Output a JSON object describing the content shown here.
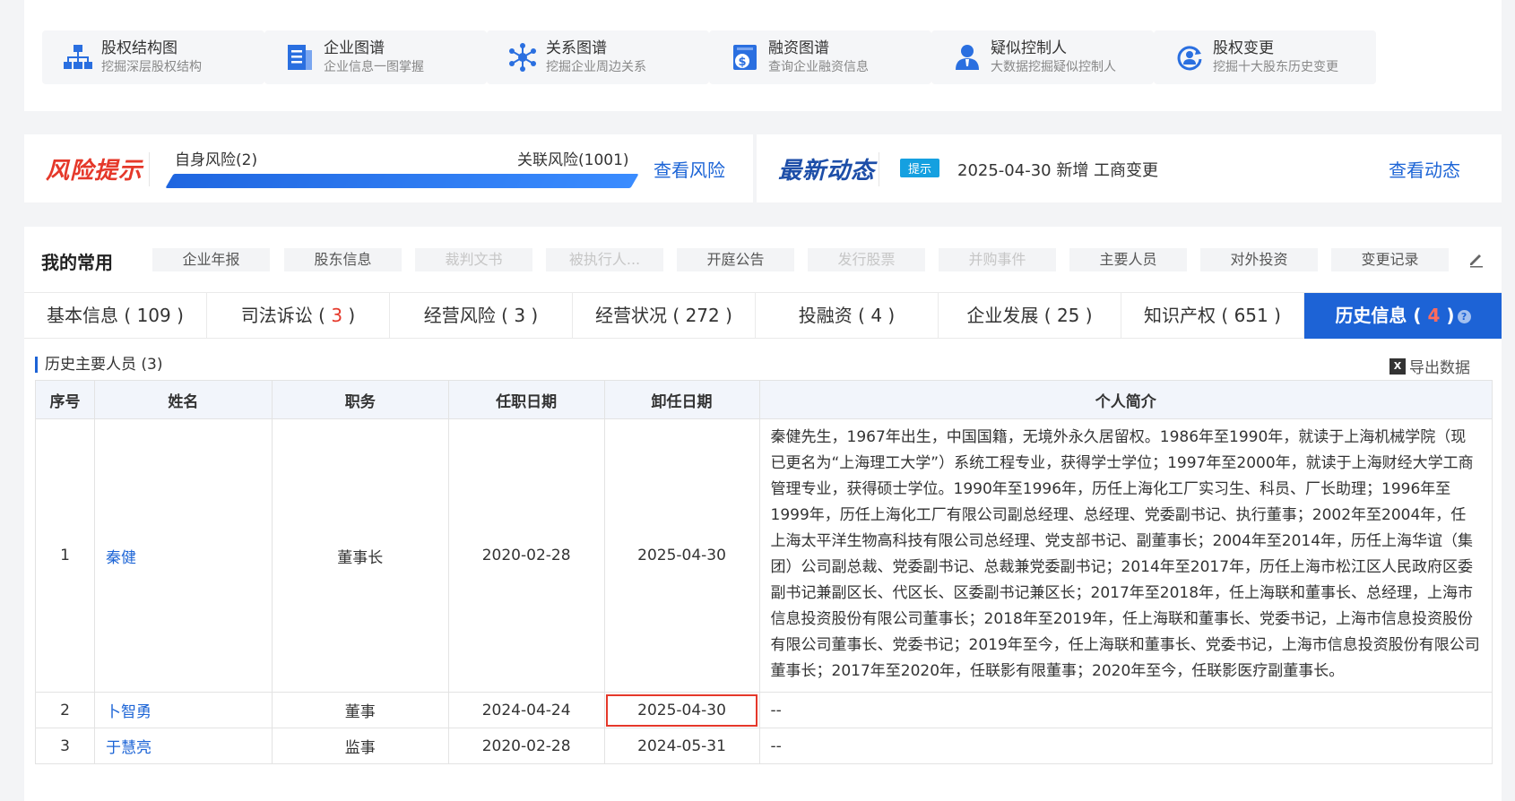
{
  "tools": [
    {
      "title": "股权结构图",
      "sub": "挖掘深层股权结构",
      "icon": "org-chart-icon"
    },
    {
      "title": "企业图谱",
      "sub": "企业信息一图掌握",
      "icon": "document-icon"
    },
    {
      "title": "关系图谱",
      "sub": "挖掘企业周边关系",
      "icon": "network-icon"
    },
    {
      "title": "融资图谱",
      "sub": "查询企业融资信息",
      "icon": "dollar-file-icon"
    },
    {
      "title": "疑似控制人",
      "sub": "大数据挖掘疑似控制人",
      "icon": "person-icon"
    },
    {
      "title": "股权变更",
      "sub": "挖掘十大股东历史变更",
      "icon": "cycle-person-icon"
    }
  ],
  "risk": {
    "title": "风险提示",
    "self": "自身风险(2)",
    "related": "关联风险(1001)",
    "link": "查看风险"
  },
  "news": {
    "title": "最新动态",
    "badge": "提示",
    "text": "2025-04-30  新增 工商变更",
    "link": "查看动态"
  },
  "favorites": {
    "title": "我的常用",
    "chips": [
      {
        "label": "企业年报",
        "disabled": false
      },
      {
        "label": "股东信息",
        "disabled": false
      },
      {
        "label": "裁判文书",
        "disabled": true
      },
      {
        "label": "被执行人...",
        "disabled": true
      },
      {
        "label": "开庭公告",
        "disabled": false
      },
      {
        "label": "发行股票",
        "disabled": true
      },
      {
        "label": "并购事件",
        "disabled": true
      },
      {
        "label": "主要人员",
        "disabled": false
      },
      {
        "label": "对外投资",
        "disabled": false
      },
      {
        "label": "变更记录",
        "disabled": false
      }
    ]
  },
  "tabs": [
    {
      "label": "基本信息",
      "count": "109",
      "red": false
    },
    {
      "label": "司法诉讼",
      "count": "3",
      "red": true
    },
    {
      "label": "经营风险",
      "count": "3",
      "red": false
    },
    {
      "label": "经营状况",
      "count": "272",
      "red": false
    },
    {
      "label": "投融资",
      "count": "4",
      "red": false
    },
    {
      "label": "企业发展",
      "count": "25",
      "red": false
    },
    {
      "label": "知识产权",
      "count": "651",
      "red": false
    },
    {
      "label": "历史信息",
      "count": "4",
      "red": true,
      "active": true
    }
  ],
  "section": {
    "title": "历史主要人员 (3)",
    "export": "导出数据"
  },
  "table": {
    "headers": [
      "序号",
      "姓名",
      "职务",
      "任职日期",
      "卸任日期",
      "个人简介"
    ],
    "rows": [
      {
        "no": "1",
        "name": "秦健",
        "title": "董事长",
        "start": "2020-02-28",
        "end": "2025-04-30",
        "bio": "秦健先生，1967年出生，中国国籍，无境外永久居留权。1986年至1990年，就读于上海机械学院（现已更名为“上海理工大学”）系统工程专业，获得学士学位；1997年至2000年，就读于上海财经大学工商管理专业，获得硕士学位。1990年至1996年，历任上海化工厂实习生、科员、厂长助理；1996年至1999年，历任上海化工厂有限公司副总经理、总经理、党委副书记、执行董事；2002年至2004年，任上海太平洋生物高科技有限公司总经理、党支部书记、副董事长；2004年至2014年，历任上海华谊（集团）公司副总裁、党委副书记、总裁兼党委副书记；2014年至2017年，历任上海市松江区人民政府区委副书记兼副区长、代区长、区委副书记兼区长；2017年至2018年，任上海联和董事长、总经理，上海市信息投资股份有限公司董事长；2018年至2019年，任上海联和董事长、党委书记，上海市信息投资股份有限公司董事长、党委书记；2019年至今，任上海联和董事长、党委书记，上海市信息投资股份有限公司董事长；2017年至2020年，任联影有限董事；2020年至今，任联影医疗副董事长。"
      },
      {
        "no": "2",
        "name": "卜智勇",
        "title": "董事",
        "start": "2024-04-24",
        "end": "2025-04-30",
        "bio": "--"
      },
      {
        "no": "3",
        "name": "于慧亮",
        "title": "监事",
        "start": "2020-02-28",
        "end": "2024-05-31",
        "bio": "--"
      }
    ]
  }
}
